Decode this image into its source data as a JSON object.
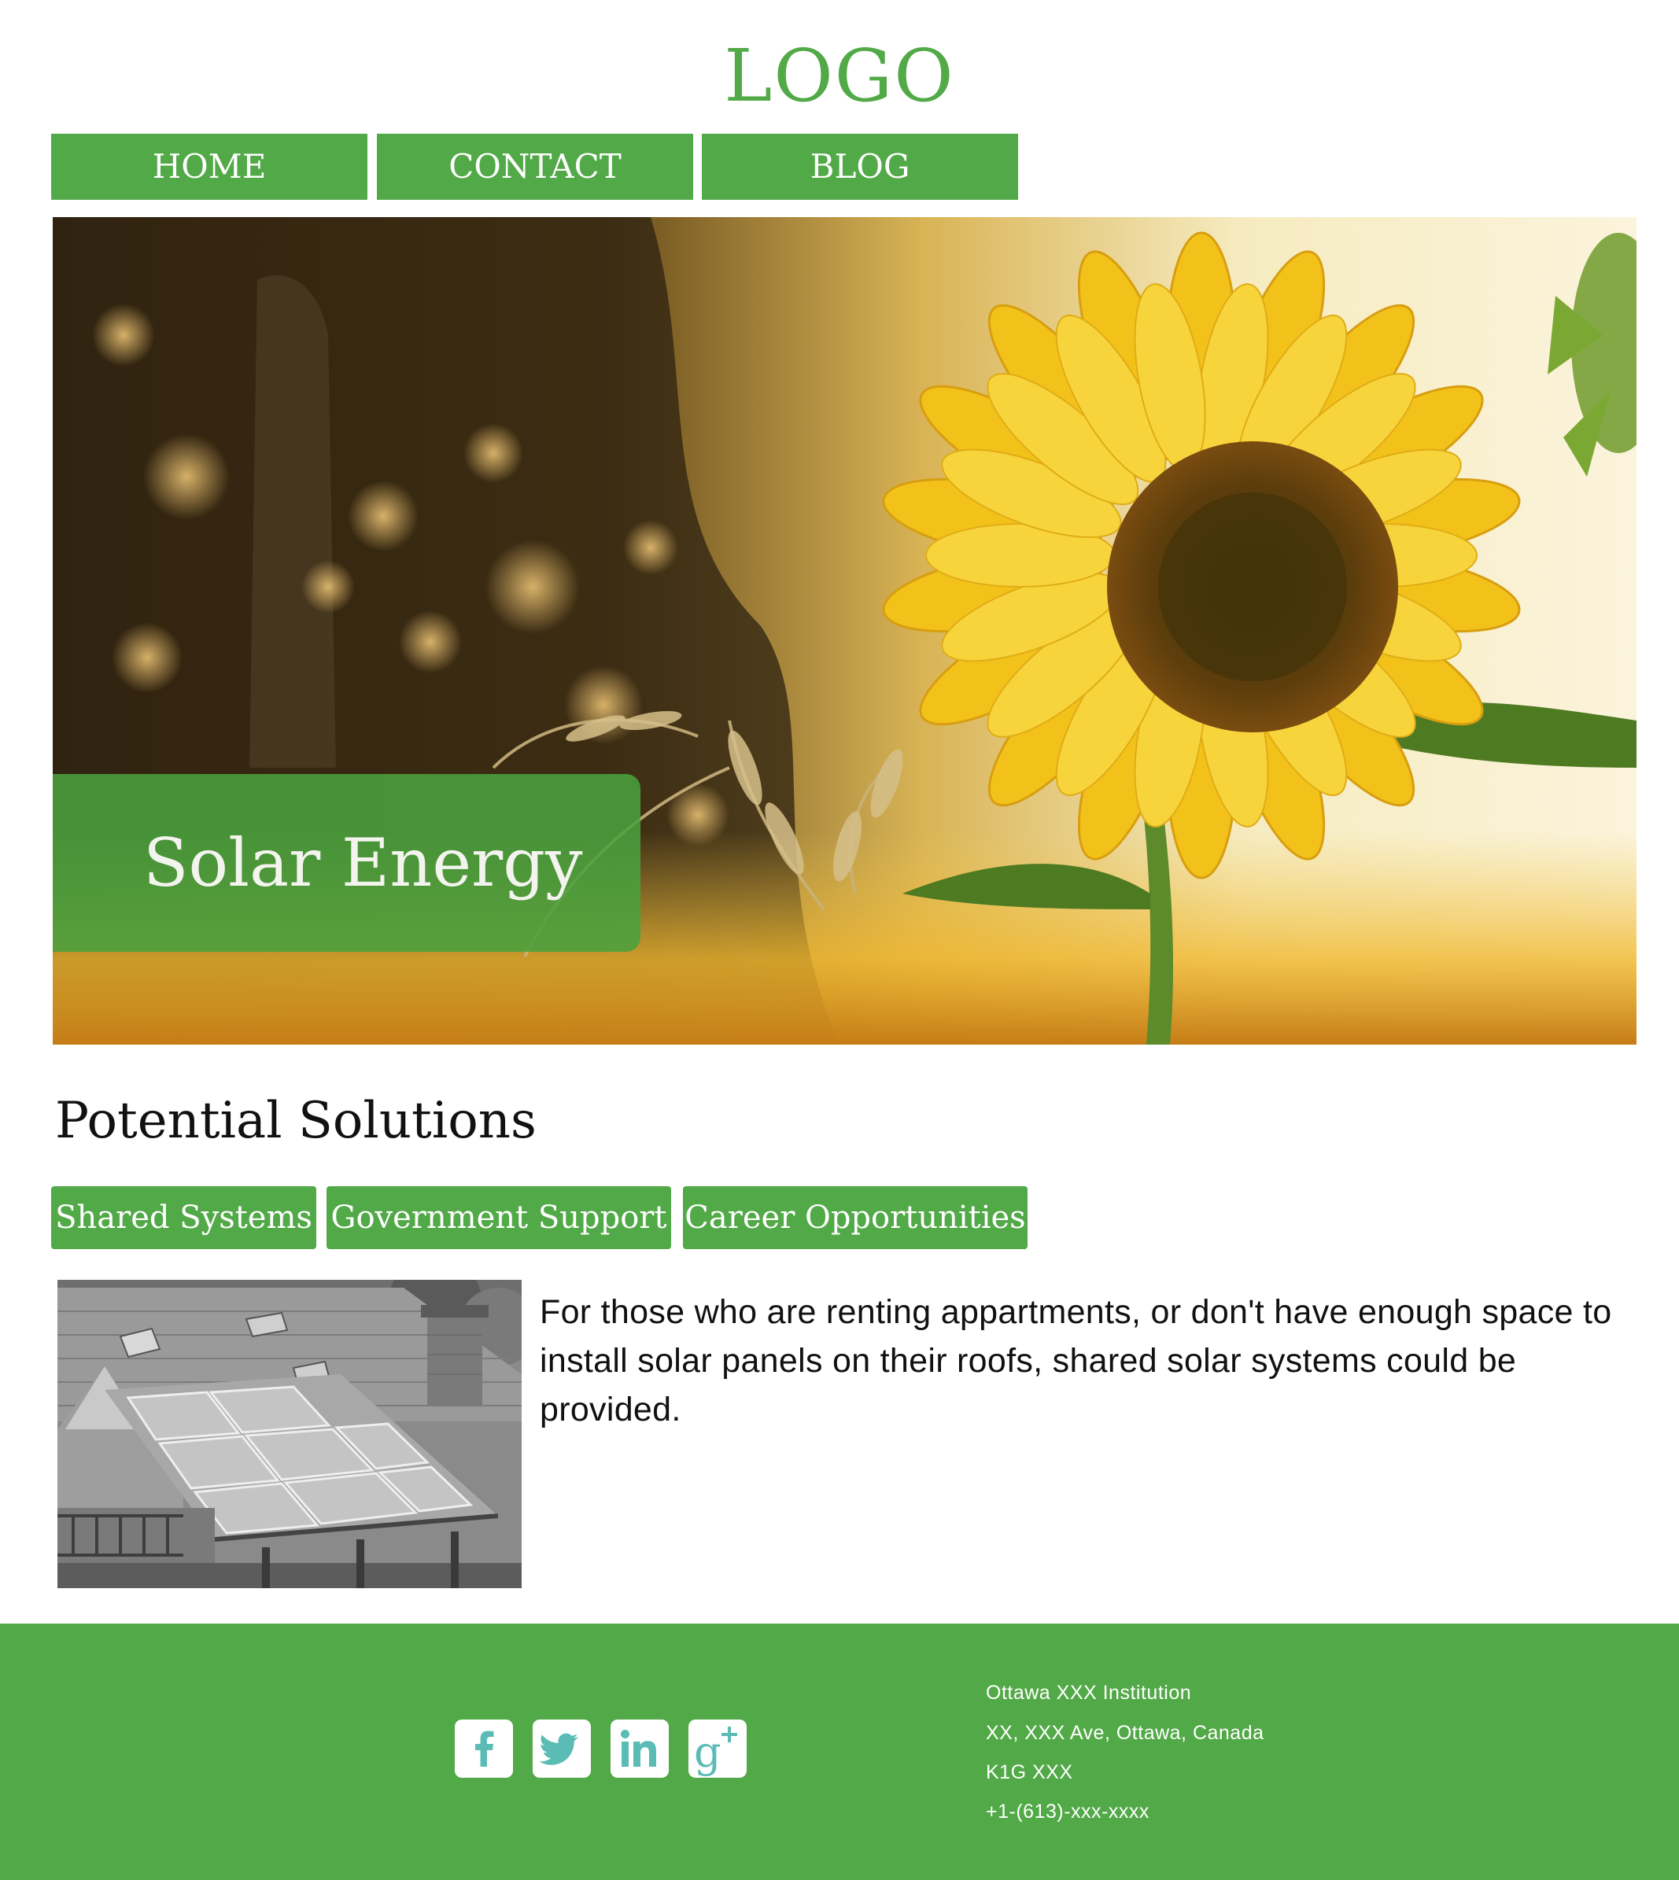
{
  "header": {
    "logo": "LOGO"
  },
  "nav": {
    "items": [
      {
        "label": "HOME"
      },
      {
        "label": "CONTACT"
      },
      {
        "label": "BLOG"
      }
    ]
  },
  "hero": {
    "title": "Solar Energy"
  },
  "solutions": {
    "title": "Potential Solutions",
    "tabs": [
      {
        "label": "Shared Systems"
      },
      {
        "label": "Government Support"
      },
      {
        "label": "Career Opportunities"
      }
    ],
    "active_text": "For those who are renting appartments, or don't have enough space to install solar panels on their roofs, shared solar systems could be provided."
  },
  "footer": {
    "social": [
      {
        "icon": "facebook-icon"
      },
      {
        "icon": "twitter-icon"
      },
      {
        "icon": "linkedin-icon"
      },
      {
        "icon": "google-plus-icon"
      }
    ],
    "address": {
      "line1": "Ottawa XXX Institution",
      "line2": "XX, XXX Ave, Ottawa, Canada",
      "line3": "K1G XXX",
      "phone": "+1-(613)-xxx-xxxx"
    }
  },
  "colors": {
    "brand_green": "#52a947",
    "icon_teal": "#5bbcb6"
  }
}
